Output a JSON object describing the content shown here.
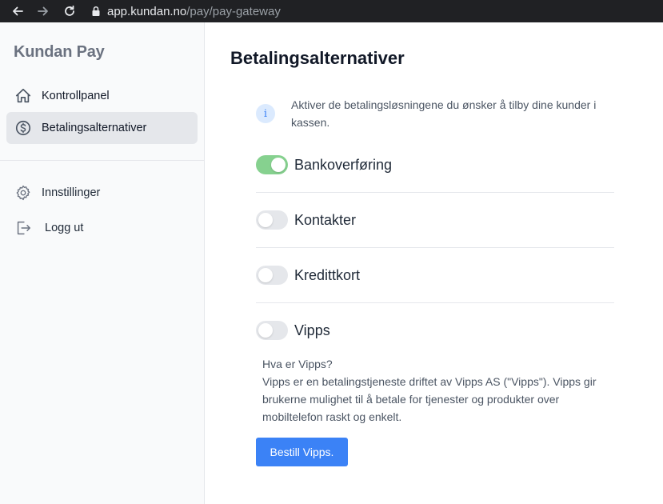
{
  "browser": {
    "url_host": "app.kundan.no",
    "url_path": "/pay/pay-gateway"
  },
  "sidebar": {
    "brand": "Kundan Pay",
    "items": [
      {
        "label": "Kontrollpanel",
        "icon": "home-icon",
        "active": false
      },
      {
        "label": "Betalingsalternativer",
        "icon": "dollar-circle-icon",
        "active": true
      }
    ],
    "secondary_items": [
      {
        "label": "Innstillinger",
        "icon": "gear-icon"
      },
      {
        "label": "Logg ut",
        "icon": "logout-icon"
      }
    ]
  },
  "main": {
    "title": "Betalingsalternativer",
    "info_text": "Aktiver de betalingsløsningene du ønsker å tilby dine kunder i kassen.",
    "options": [
      {
        "label": "Bankoverføring",
        "enabled": true
      },
      {
        "label": "Kontakter",
        "enabled": false
      },
      {
        "label": "Kredittkort",
        "enabled": false
      },
      {
        "label": "Vipps",
        "enabled": false
      }
    ],
    "vipps_heading": "Hva er Vipps?",
    "vipps_description": "Vipps er en betalingstjeneste driftet av Vipps AS (\"Vipps\"). Vipps gir brukerne mulighet til å betale for tjenester og produkter over mobiltelefon raskt og enkelt.",
    "order_button": "Bestill Vipps."
  },
  "colors": {
    "accent": "#3b82f6",
    "toggle_on": "#86d18f",
    "toggle_off": "#e5e7eb"
  }
}
